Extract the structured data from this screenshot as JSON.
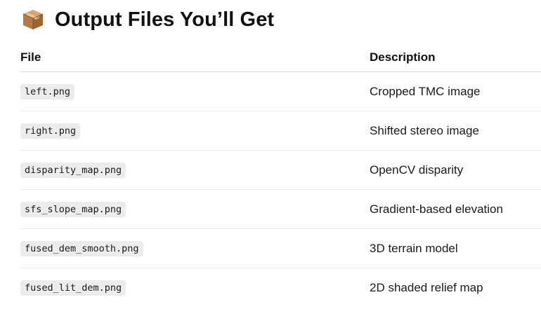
{
  "heading": {
    "icon": "package-icon",
    "title": "Output Files You’ll Get"
  },
  "table": {
    "headers": {
      "file": "File",
      "description": "Description"
    },
    "rows": [
      {
        "file": "left.png",
        "description": "Cropped TMC image"
      },
      {
        "file": "right.png",
        "description": "Shifted stereo image"
      },
      {
        "file": "disparity_map.png",
        "description": "OpenCV disparity"
      },
      {
        "file": "sfs_slope_map.png",
        "description": "Gradient-based elevation"
      },
      {
        "file": "fused_dem_smooth.png",
        "description": "3D terrain model"
      },
      {
        "file": "fused_lit_dem.png",
        "description": "2D shaded relief map"
      }
    ]
  },
  "colors": {
    "chip_background": "#ececec",
    "header_rule": "#d9d9d9",
    "row_rule": "#ededed"
  }
}
